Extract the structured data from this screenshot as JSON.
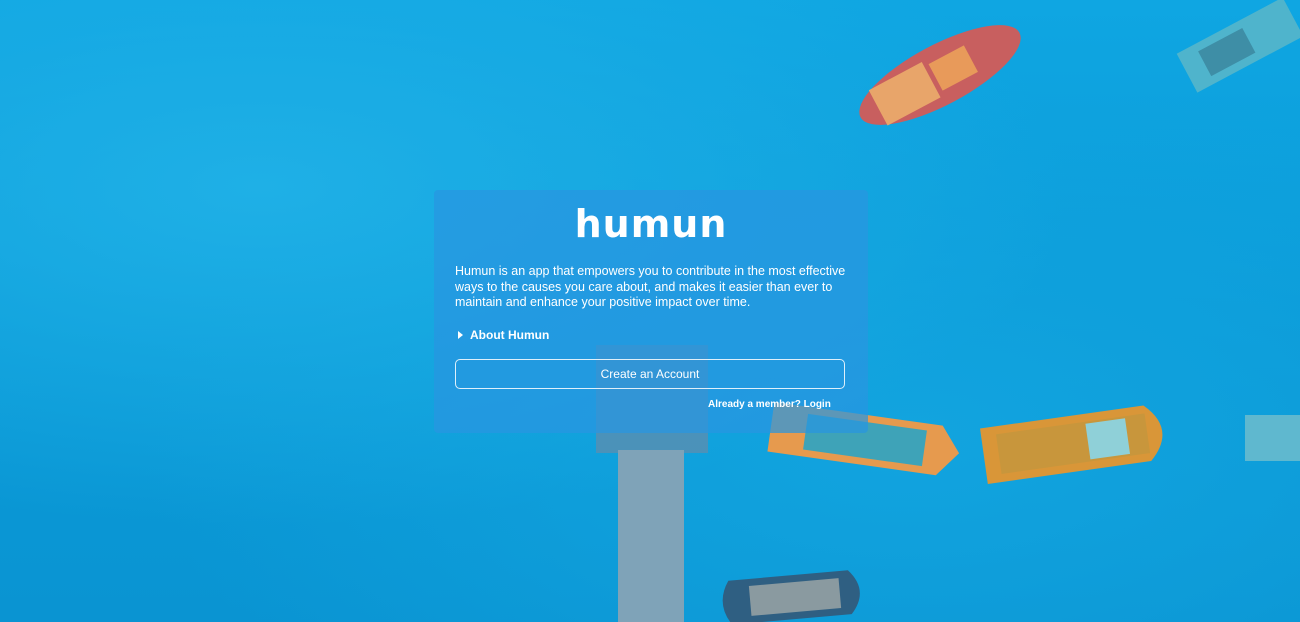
{
  "brand": {
    "name": "humun"
  },
  "intro": {
    "description": "Humun is an app that empowers you to contribute in the most effective ways to the causes you care about, and makes it easier than ever to maintain and enhance your positive impact over time."
  },
  "about": {
    "label": "About Humun"
  },
  "actions": {
    "create_account_label": "Create an Account",
    "login_label": "Already a member? Login"
  },
  "colors": {
    "water": "#0fa6e2",
    "card": "#2896e1",
    "text": "#ffffff"
  },
  "icons": {
    "about_toggle": "caret-right-icon"
  }
}
